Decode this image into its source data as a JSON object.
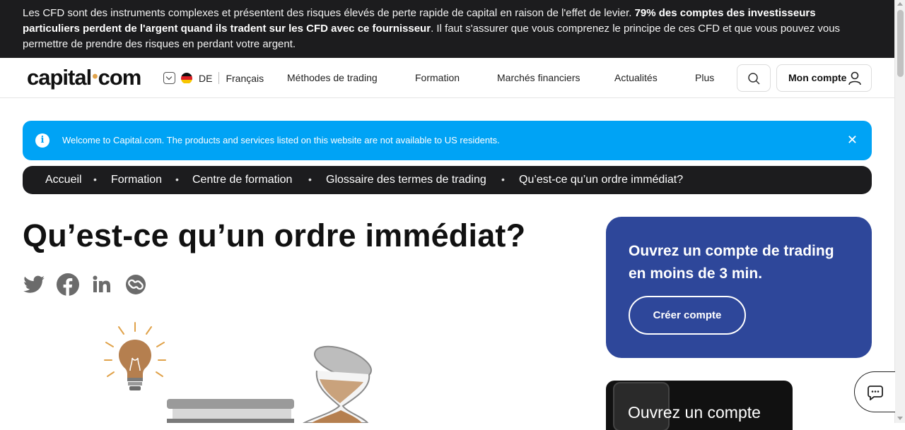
{
  "risk_warning": {
    "text_before": "Les CFD sont des instruments complexes et présentent des risques élevés de perte rapide de capital en raison de l'effet de levier. ",
    "text_bold": "79% des comptes des investisseurs particuliers perdent de l'argent quand ils tradent sur les CFD avec ce fournisseur",
    "text_after": ". Il faut s'assurer que vous comprenez le principe de ces CFD et que vous pouvez vous permettre de prendre des risques en perdant votre argent."
  },
  "header": {
    "logo_left": "capital",
    "logo_dot": "•",
    "logo_right": "com",
    "country_code": "DE",
    "language": "Français",
    "nav": [
      "Méthodes de trading",
      "Formation",
      "Marchés financiers",
      "Actualités",
      "Plus"
    ],
    "account_label": "Mon compte"
  },
  "notice": {
    "info_glyph": "i",
    "text": "Welcome to Capital.com. The products and services listed on this website are not available to US residents.",
    "close_glyph": "✕"
  },
  "breadcrumb": {
    "items": [
      "Accueil",
      "Formation",
      "Centre de formation",
      "Glossaire des termes de trading",
      "Qu’est-ce qu’un ordre immédiat?"
    ],
    "separator": "•"
  },
  "page": {
    "title": "Qu’est-ce qu’un ordre immédiat?"
  },
  "share_icons": [
    "twitter-icon",
    "facebook-icon",
    "linkedin-icon",
    "link-icon"
  ],
  "cta": {
    "heading": "Ouvrez un compte de trading en moins de 3 min.",
    "button": "Créer compte"
  },
  "promo_card": {
    "text": "Ouvrez un compte"
  },
  "colors": {
    "risk_bar_bg": "#1c1c1e",
    "notice_bg": "#00a3f5",
    "cta_bg": "#2e479a",
    "breadcrumb_bg": "#1c1c1e",
    "share_icon": "#6b6b6b"
  }
}
